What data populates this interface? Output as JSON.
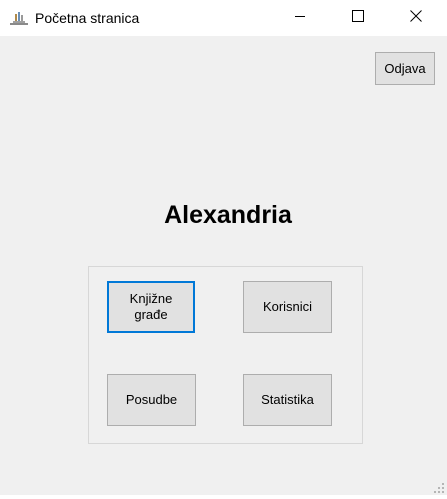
{
  "window": {
    "title": "Početna stranica"
  },
  "toolbar": {
    "logout_label": "Odjava"
  },
  "main": {
    "app_title": "Alexandria",
    "buttons": {
      "books": "Knjižne\ngrađe",
      "users": "Korisnici",
      "loans": "Posudbe",
      "stats": "Statistika"
    }
  },
  "icons": {
    "app": "library-app-icon",
    "minimize": "minimize-icon",
    "maximize": "maximize-icon",
    "close": "close-icon"
  },
  "colors": {
    "window_bg": "#f0f0f0",
    "titlebar_bg": "#ffffff",
    "button_bg": "#e1e1e1",
    "button_border": "#adadad",
    "focus_border": "#0078d7"
  }
}
